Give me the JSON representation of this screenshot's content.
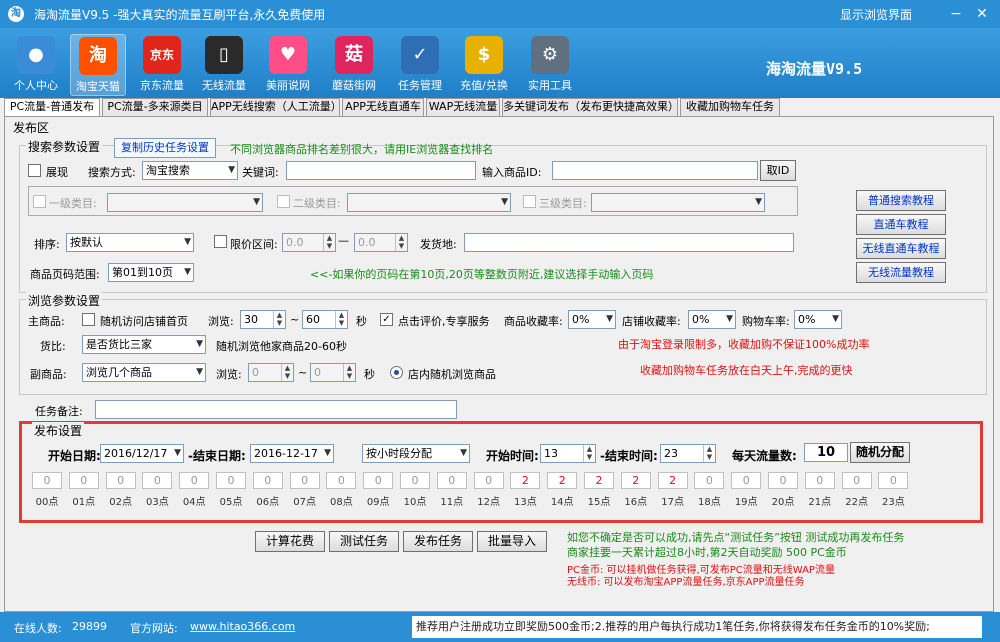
{
  "titlebar": {
    "title": "海淘流量V9.5 -强大真实的流量互刷平台,永久免费使用",
    "browser_link": "显示浏览界面"
  },
  "toolbar": {
    "items": [
      {
        "label": "个人中心",
        "icon": "person-icon",
        "color": "#3a8bd8",
        "glyph": "●"
      },
      {
        "label": "淘宝天猫",
        "icon": "taobao-icon",
        "color": "#ff5000",
        "glyph": "淘"
      },
      {
        "label": "京东流量",
        "icon": "jd-icon",
        "color": "#e1251b",
        "glyph": "京东"
      },
      {
        "label": "无线流量",
        "icon": "phone-icon",
        "color": "#2a2a2a",
        "glyph": "▯"
      },
      {
        "label": "美丽说网",
        "icon": "meilishuo-icon",
        "color": "#ff4d88",
        "glyph": "♥"
      },
      {
        "label": "蘑菇街网",
        "icon": "mogujie-icon",
        "color": "#e0245e",
        "glyph": "菇"
      },
      {
        "label": "任务管理",
        "icon": "task-icon",
        "color": "#2f6db5",
        "glyph": "✓"
      },
      {
        "label": "充值/兑换",
        "icon": "coin-icon",
        "color": "#e8b000",
        "glyph": "$"
      },
      {
        "label": "实用工具",
        "icon": "robot-icon",
        "color": "#607080",
        "glyph": "⚙"
      }
    ],
    "brand": "海淘流量V9.5"
  },
  "tabs": [
    "PC流量-普通发布",
    "PC流量-多来源类目",
    "APP无线搜索（人工流量）",
    "APP无线直通车",
    "WAP无线流量",
    "多关键词发布（发布更快捷高效果）",
    "收藏加购物车任务"
  ],
  "publish_area": {
    "label": "发布区",
    "search": {
      "group_label": "搜索参数设置",
      "history_button": "复制历史任务设置",
      "notice": "不同浏览器商品排名差别很大，请用IE浏览器查找排名",
      "exhibit_label": "展现",
      "search_mode_label": "搜索方式:",
      "search_mode_value": "淘宝搜索",
      "keyword_label": "关键词:",
      "product_id_label": "输入商品ID:",
      "get_id_button": "取ID",
      "cat1_label": "一级类目:",
      "cat2_label": "二级类目:",
      "cat3_label": "三级类目:",
      "sort_label": "排序:",
      "sort_value": "按默认",
      "price_label": "限价区间:",
      "price_min": "0.0",
      "price_max": "0.0",
      "ship_label": "发货地:",
      "page_label": "商品页码范围:",
      "page_value": "第01到10页",
      "page_hint": "<<-如果你的页码在第10页,20页等整数页附近,建议选择手动输入页码"
    },
    "tutorials": [
      "普通搜索教程",
      "直通车教程",
      "无线直通车教程",
      "无线流量教程"
    ],
    "browse": {
      "group_label": "浏览参数设置",
      "main_label": "主商品:",
      "random_shop_label": "随机访问店铺首页",
      "browse_label": "浏览:",
      "browse_min": "30",
      "browse_max": "60",
      "sec_label": "秒",
      "review_label": "点击评价,专享服务",
      "fav_label": "商品收藏率:",
      "fav_value": "0%",
      "shop_fav_label": "店铺收藏率:",
      "shop_fav_value": "0%",
      "cart_label": "购物车率:",
      "cart_value": "0%",
      "compare_label": "货比:",
      "compare_value": "是否货比三家",
      "compare_hint": "随机浏览他家商品20-60秒",
      "notice1": "由于淘宝登录限制多，收藏加购不保证100%成功率",
      "sub_label": "副商品:",
      "sub_value": "浏览几个商品",
      "sub_browse_label": "浏览:",
      "sub_browse_min": "0",
      "sub_browse_max": "0",
      "sub_sec_label": "秒",
      "in_shop_label": "店内随机浏览商品",
      "notice2": "收藏加购物车任务放在白天上午,完成的更快"
    },
    "remark_label": "任务备注:"
  },
  "publish_settings": {
    "label": "发布设置",
    "start_date_label": "开始日期:",
    "start_date": "2016/12/17",
    "end_date_label": "-结束日期:",
    "end_date": "2016-12-17",
    "mode_value": "按小时段分配",
    "start_time_label": "开始时间:",
    "start_time": "13",
    "end_time_label": "-结束时间:",
    "end_time": "23",
    "daily_label": "每天流量数:",
    "daily_value": "10",
    "random_button": "随机分配",
    "hours": [
      {
        "v": "0",
        "l": "00点"
      },
      {
        "v": "0",
        "l": "01点"
      },
      {
        "v": "0",
        "l": "02点"
      },
      {
        "v": "0",
        "l": "03点"
      },
      {
        "v": "0",
        "l": "04点"
      },
      {
        "v": "0",
        "l": "05点"
      },
      {
        "v": "0",
        "l": "06点"
      },
      {
        "v": "0",
        "l": "07点"
      },
      {
        "v": "0",
        "l": "08点"
      },
      {
        "v": "0",
        "l": "09点"
      },
      {
        "v": "0",
        "l": "10点"
      },
      {
        "v": "0",
        "l": "11点"
      },
      {
        "v": "0",
        "l": "12点"
      },
      {
        "v": "2",
        "l": "13点"
      },
      {
        "v": "2",
        "l": "14点"
      },
      {
        "v": "2",
        "l": "15点"
      },
      {
        "v": "2",
        "l": "16点"
      },
      {
        "v": "2",
        "l": "17点"
      },
      {
        "v": "0",
        "l": "18点"
      },
      {
        "v": "0",
        "l": "19点"
      },
      {
        "v": "0",
        "l": "20点"
      },
      {
        "v": "0",
        "l": "21点"
      },
      {
        "v": "0",
        "l": "22点"
      },
      {
        "v": "0",
        "l": "23点"
      }
    ]
  },
  "actions": {
    "calc": "计算花费",
    "test": "测试任务",
    "publish": "发布任务",
    "import": "批量导入"
  },
  "footer_notes": {
    "line1": "如您不确定是否可以成功,请先点“测试任务”按钮 测试成功再发布任务",
    "line2": "商家挂要一天累计超过8小时,第2天自动奖励 500 PC金币",
    "line3": "PC金币: 可以挂机做任务获得,可发布PC流量和无线WAP流量",
    "line4": "无线币: 可以发布淘宝APP流量任务,京东APP流量任务"
  },
  "statusbar": {
    "online_label": "在线人数:",
    "online_count": "29899",
    "site_label": "官方网站:",
    "site_url": "www.hitao366.com",
    "notice": "推荐用户注册成功立即奖励500金币;2.推荐的用户每执行成功1笔任务,你将获得发布任务金币的10%奖励;"
  }
}
